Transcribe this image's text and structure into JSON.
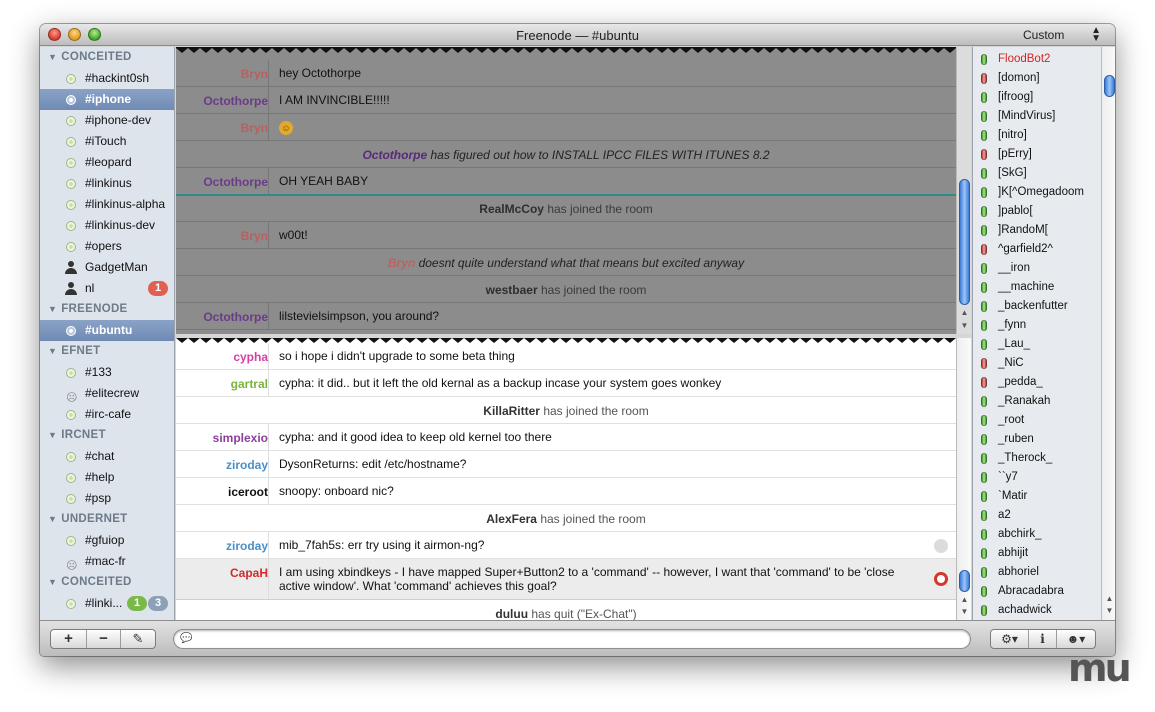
{
  "window": {
    "title": "Freenode — #ubuntu",
    "style_select": "Custom"
  },
  "sidebar": {
    "entries": [
      {
        "kind": "group",
        "label": "CONCEITED"
      },
      {
        "kind": "channel",
        "label": "#hackint0sh"
      },
      {
        "kind": "channel",
        "label": "#iphone",
        "selected": true
      },
      {
        "kind": "channel",
        "label": "#iphone-dev"
      },
      {
        "kind": "channel",
        "label": "#iTouch"
      },
      {
        "kind": "channel",
        "label": "#leopard"
      },
      {
        "kind": "channel",
        "label": "#linkinus"
      },
      {
        "kind": "channel",
        "label": "#linkinus-alpha"
      },
      {
        "kind": "channel",
        "label": "#linkinus-dev"
      },
      {
        "kind": "channel",
        "label": "#opers"
      },
      {
        "kind": "query",
        "label": "GadgetMan"
      },
      {
        "kind": "query",
        "label": "nl",
        "badge": "1",
        "badge_color": "red"
      },
      {
        "kind": "group",
        "label": "FREENODE"
      },
      {
        "kind": "channel",
        "label": "#ubuntu",
        "selected": true
      },
      {
        "kind": "group",
        "label": "EFNET"
      },
      {
        "kind": "channel",
        "label": "#133"
      },
      {
        "kind": "channel-face",
        "label": "#elitecrew"
      },
      {
        "kind": "channel",
        "label": "#irc-cafe"
      },
      {
        "kind": "group",
        "label": "IRCNET"
      },
      {
        "kind": "channel",
        "label": "#chat"
      },
      {
        "kind": "channel",
        "label": "#help"
      },
      {
        "kind": "channel",
        "label": "#psp"
      },
      {
        "kind": "group",
        "label": "UNDERNET"
      },
      {
        "kind": "channel",
        "label": "#gfuiop"
      },
      {
        "kind": "channel-face",
        "label": "#mac-fr"
      },
      {
        "kind": "group",
        "label": "CONCEITED"
      },
      {
        "kind": "channel",
        "label": "#linki...",
        "badge": "1",
        "badge_color": "green",
        "badge2": "3"
      }
    ]
  },
  "chat_top": {
    "rows": [
      {
        "type": "msg",
        "nick": "Bryn",
        "nick_color": "#b86060",
        "text": "hey Octothorpe",
        "h": 27
      },
      {
        "type": "msg",
        "nick": "Octothorpe",
        "nick_color": "#6b3b8a",
        "text": "I AM INVINCIBLE!!!!!",
        "h": 27
      },
      {
        "type": "emoji",
        "nick": "Bryn",
        "nick_color": "#b86060",
        "text": "☺",
        "h": 27
      },
      {
        "type": "action",
        "nick": "Octothorpe",
        "nick_color": "#5a2a7a",
        "text": "has figured out how to INSTALL IPCC FILES WITH ITUNES 8.2",
        "h": 27
      },
      {
        "type": "msg",
        "nick": "Octothorpe",
        "nick_color": "#6b3b8a",
        "text": "OH YEAH BABY",
        "h": 27
      },
      {
        "type": "event",
        "nick": "RealMcCoy",
        "text": "has joined the room",
        "h": 27
      },
      {
        "type": "msg",
        "nick": "Bryn",
        "nick_color": "#b86060",
        "text": "w00t!",
        "h": 27
      },
      {
        "type": "action",
        "nick": "Bryn",
        "nick_color": "#c06060",
        "text": "doesnt quite understand what that means but excited anyway",
        "h": 27
      },
      {
        "type": "event",
        "nick": "westbaer",
        "text": "has joined the room",
        "h": 27
      },
      {
        "type": "msg",
        "nick": "Octothorpe",
        "nick_color": "#6b3b8a",
        "text": "lilstevielsimpson, you around?",
        "h": 27
      }
    ]
  },
  "chat_bottom": {
    "rows": [
      {
        "type": "msg",
        "nick": "cypha",
        "nick_color": "#d43fa5",
        "text": "so i hope i didn't upgrade to some beta thing",
        "h": 27
      },
      {
        "type": "msg",
        "nick": "gartral",
        "nick_color": "#7ab43a",
        "text": "cypha: it did.. but it left the old kernal as a backup incase your system goes wonkey",
        "h": 27
      },
      {
        "type": "event",
        "nick": "KillaRitter",
        "text": "has joined the room",
        "h": 27
      },
      {
        "type": "msg",
        "nick": "simplexio",
        "nick_color": "#8a3f9c",
        "text": "cypha: and it good idea to keep old kernel too there",
        "h": 27
      },
      {
        "type": "msg",
        "nick": "ziroday",
        "nick_color": "#4a90c8",
        "text": "DysonReturns: edit /etc/hostname?",
        "h": 27
      },
      {
        "type": "msg",
        "nick": "iceroot",
        "nick_color": "#111111",
        "text": "snoopy: onboard nic?",
        "h": 27
      },
      {
        "type": "event",
        "nick": "AlexFera",
        "text": "has joined the room",
        "h": 27
      },
      {
        "type": "msg",
        "nick": "ziroday",
        "nick_color": "#4a90c8",
        "text": "mib_7fah5s: err try using it airmon-ng?",
        "h": 27,
        "status": "grey"
      },
      {
        "type": "msg",
        "nick": "CapaH",
        "nick_color": "#d22a2a",
        "text": "I am using xbindkeys - I have mapped Super+Button2 to a 'command' -- however, I want that 'command' to be 'close active window'. What 'command' achieves this goal?",
        "h": 41,
        "status": "red",
        "highlight": true
      },
      {
        "type": "event",
        "nick": "duluu",
        "text": "has quit (\"Ex-Chat\")",
        "h": 27
      }
    ]
  },
  "users": [
    {
      "name": "FloodBot2",
      "lamp": "g",
      "hl": true
    },
    {
      "name": "[domon]",
      "lamp": "r"
    },
    {
      "name": "[ifroog]",
      "lamp": "g"
    },
    {
      "name": "[MindVirus]",
      "lamp": "g"
    },
    {
      "name": "[nitro]",
      "lamp": "g"
    },
    {
      "name": "[pErry]",
      "lamp": "r"
    },
    {
      "name": "[SkG]",
      "lamp": "g"
    },
    {
      "name": "]K[^Omegadoom",
      "lamp": "g"
    },
    {
      "name": "]pablo[",
      "lamp": "g"
    },
    {
      "name": "]RandoM[",
      "lamp": "g"
    },
    {
      "name": "^garfield2^",
      "lamp": "r"
    },
    {
      "name": "__iron",
      "lamp": "g"
    },
    {
      "name": "__machine",
      "lamp": "g"
    },
    {
      "name": "_backenfutter",
      "lamp": "g"
    },
    {
      "name": "_fynn",
      "lamp": "g"
    },
    {
      "name": "_Lau_",
      "lamp": "g"
    },
    {
      "name": "_NiC",
      "lamp": "r"
    },
    {
      "name": "_pedda_",
      "lamp": "r"
    },
    {
      "name": "_Ranakah",
      "lamp": "g"
    },
    {
      "name": "_root",
      "lamp": "g"
    },
    {
      "name": "_ruben",
      "lamp": "g"
    },
    {
      "name": "_Therock_",
      "lamp": "g"
    },
    {
      "name": "``y7",
      "lamp": "g"
    },
    {
      "name": "`Matir",
      "lamp": "g"
    },
    {
      "name": "a2",
      "lamp": "g"
    },
    {
      "name": "abchirk_",
      "lamp": "g"
    },
    {
      "name": "abhijit",
      "lamp": "g"
    },
    {
      "name": "abhoriel",
      "lamp": "g"
    },
    {
      "name": "Abracadabra",
      "lamp": "g"
    },
    {
      "name": "achadwick",
      "lamp": "g"
    }
  ],
  "toolbar": {
    "add_label": "+",
    "remove_label": "−",
    "edit_label": "✎",
    "input_placeholder": "",
    "gear_label": "⚙▾",
    "info_label": "i",
    "user_label": "☻▾"
  },
  "colors": {
    "event_nick": "#333333",
    "event_text": "#555555",
    "selection": "#7d96bd"
  }
}
